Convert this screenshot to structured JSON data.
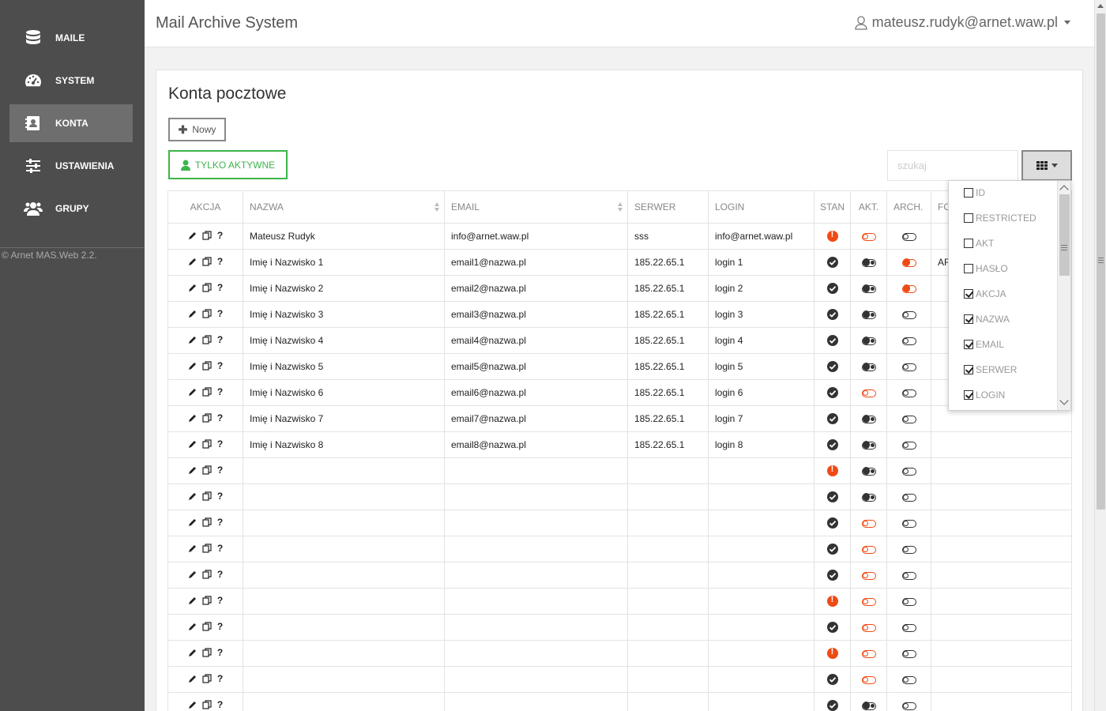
{
  "app": {
    "title": "Mail Archive System",
    "user": "mateusz.rudyk@arnet.waw.pl"
  },
  "sidebar": {
    "items": [
      {
        "label": "MAILE",
        "icon": "database-icon",
        "active": false
      },
      {
        "label": "SYSTEM",
        "icon": "dashboard-icon",
        "active": false
      },
      {
        "label": "KONTA",
        "icon": "address-book-icon",
        "active": true
      },
      {
        "label": "USTAWIENIA",
        "icon": "sliders-icon",
        "active": false
      },
      {
        "label": "GRUPY",
        "icon": "users-icon",
        "active": false
      }
    ],
    "copyright": "© Arnet MAS.Web 2.2."
  },
  "page": {
    "title": "Konta pocztowe",
    "new_label": "Nowy",
    "active_only_label": "TYLKO AKTYWNE",
    "search_placeholder": "szukaj"
  },
  "table": {
    "headers": [
      "AKCJA",
      "NAZWA",
      "EMAIL",
      "SERWER",
      "LOGIN",
      "STAN",
      "AKT.",
      "ARCH.",
      "FO"
    ],
    "rows": [
      {
        "nazwa": "Mateusz Rudyk",
        "email": "info@arnet.waw.pl",
        "serwer": "sss",
        "login": "info@arnet.waw.pl",
        "stan": "error",
        "akt": "off-orange",
        "arch": "off",
        "extra": ""
      },
      {
        "nazwa": "Imię i Nazwisko 1",
        "email": "email1@nazwa.pl",
        "serwer": "185.22.65.1",
        "login": "login 1",
        "stan": "ok",
        "akt": "on",
        "arch": "on-orange",
        "extra": "AR"
      },
      {
        "nazwa": "Imię i Nazwisko 2",
        "email": "email2@nazwa.pl",
        "serwer": "185.22.65.1",
        "login": "login 2",
        "stan": "ok",
        "akt": "on",
        "arch": "on-orange",
        "extra": ""
      },
      {
        "nazwa": "Imię i Nazwisko 3",
        "email": "email3@nazwa.pl",
        "serwer": "185.22.65.1",
        "login": "login 3",
        "stan": "ok",
        "akt": "on",
        "arch": "off",
        "extra": ""
      },
      {
        "nazwa": "Imię i Nazwisko 4",
        "email": "email4@nazwa.pl",
        "serwer": "185.22.65.1",
        "login": "login 4",
        "stan": "ok",
        "akt": "on",
        "arch": "off",
        "extra": ""
      },
      {
        "nazwa": "Imię i Nazwisko 5",
        "email": "email5@nazwa.pl",
        "serwer": "185.22.65.1",
        "login": "login 5",
        "stan": "ok",
        "akt": "on",
        "arch": "off",
        "extra": ""
      },
      {
        "nazwa": "Imię i Nazwisko 6",
        "email": "email6@nazwa.pl",
        "serwer": "185.22.65.1",
        "login": "login 6",
        "stan": "ok",
        "akt": "off-orange",
        "arch": "off",
        "extra": ""
      },
      {
        "nazwa": "Imię i Nazwisko 7",
        "email": "email7@nazwa.pl",
        "serwer": "185.22.65.1",
        "login": "login 7",
        "stan": "ok",
        "akt": "on",
        "arch": "off",
        "extra": ""
      },
      {
        "nazwa": "Imię i Nazwisko 8",
        "email": "email8@nazwa.pl",
        "serwer": "185.22.65.1",
        "login": "login 8",
        "stan": "ok",
        "akt": "on",
        "arch": "off",
        "extra": ""
      },
      {
        "nazwa": "",
        "email": "",
        "serwer": "",
        "login": "",
        "stan": "error",
        "akt": "on",
        "arch": "off",
        "extra": ""
      },
      {
        "nazwa": "",
        "email": "",
        "serwer": "",
        "login": "",
        "stan": "ok",
        "akt": "on",
        "arch": "off",
        "extra": ""
      },
      {
        "nazwa": "",
        "email": "",
        "serwer": "",
        "login": "",
        "stan": "ok",
        "akt": "off-orange",
        "arch": "off",
        "extra": ""
      },
      {
        "nazwa": "",
        "email": "",
        "serwer": "",
        "login": "",
        "stan": "ok",
        "akt": "off-orange",
        "arch": "off",
        "extra": ""
      },
      {
        "nazwa": "",
        "email": "",
        "serwer": "",
        "login": "",
        "stan": "ok",
        "akt": "off-orange",
        "arch": "off",
        "extra": ""
      },
      {
        "nazwa": "",
        "email": "",
        "serwer": "",
        "login": "",
        "stan": "error",
        "akt": "off-orange",
        "arch": "off",
        "extra": ""
      },
      {
        "nazwa": "",
        "email": "",
        "serwer": "",
        "login": "",
        "stan": "ok",
        "akt": "off-orange",
        "arch": "off",
        "extra": ""
      },
      {
        "nazwa": "",
        "email": "",
        "serwer": "",
        "login": "",
        "stan": "error",
        "akt": "off-orange",
        "arch": "off",
        "extra": ""
      },
      {
        "nazwa": "",
        "email": "",
        "serwer": "",
        "login": "",
        "stan": "ok",
        "akt": "off-orange",
        "arch": "off",
        "extra": ""
      },
      {
        "nazwa": "",
        "email": "",
        "serwer": "",
        "login": "",
        "stan": "ok",
        "akt": "on",
        "arch": "off",
        "extra": ""
      }
    ]
  },
  "column_menu": {
    "items": [
      {
        "label": "ID",
        "checked": false
      },
      {
        "label": "RESTRICTED",
        "checked": false
      },
      {
        "label": "AKT",
        "checked": false
      },
      {
        "label": "HASŁO",
        "checked": false
      },
      {
        "label": "AKCJA",
        "checked": true
      },
      {
        "label": "NAZWA",
        "checked": true
      },
      {
        "label": "EMAIL",
        "checked": true
      },
      {
        "label": "SERWER",
        "checked": true
      },
      {
        "label": "LOGIN",
        "checked": true
      }
    ]
  },
  "colors": {
    "green": "#3cb54a",
    "orange": "#f04a14",
    "sidebar": "#4d4d4d",
    "sidebar_active": "#6e6e6e"
  }
}
